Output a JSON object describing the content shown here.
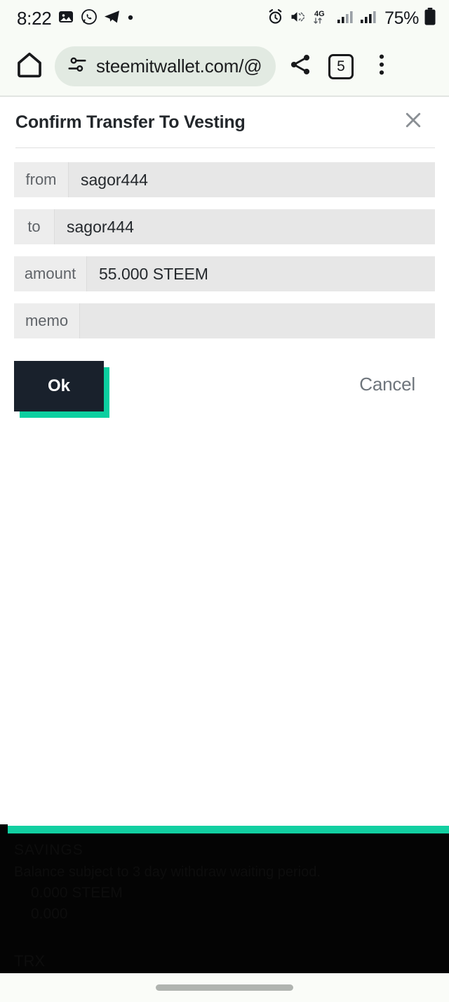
{
  "status_bar": {
    "time": "8:22",
    "left_icons": [
      "gallery-icon",
      "whatsapp-icon",
      "telegram-icon",
      "dot-icon"
    ],
    "right_icons": [
      "alarm-icon",
      "mute-icon",
      "4g-icon",
      "signal-1-icon",
      "signal-2-icon"
    ],
    "network_label": "4G",
    "battery_percent": "75%"
  },
  "browser": {
    "home_icon": "home-icon",
    "site_settings_icon": "tune-icon",
    "url": "steemitwallet.com/@",
    "share_icon": "share-icon",
    "tab_count": "5",
    "menu_icon": "more-vertical-icon",
    "url_pill_color": "#e2eae2",
    "chrome_bg": "#f8fbf6"
  },
  "dialog": {
    "title": "Confirm Transfer To Vesting",
    "close_icon": "close-icon",
    "fields": [
      {
        "label": "from",
        "value": "sagor444"
      },
      {
        "label": "to",
        "value": "sagor444"
      },
      {
        "label": "amount",
        "value": "55.000 STEEM"
      },
      {
        "label": "memo",
        "value": ""
      }
    ],
    "confirm_label": "Ok",
    "cancel_label": "Cancel",
    "confirm_bg": "#19212c",
    "confirm_shadow": "#0ccfa0",
    "cancel_color": "#6e757c"
  },
  "background_page": {
    "accent_bar_color": "#12cfa1",
    "savings_heading": "SAVINGS",
    "savings_note": "Balance subject to 3 day withdraw waiting period.",
    "savings_rows": [
      "0.000 STEEM",
      "0.000"
    ],
    "footer_label": "TRX"
  },
  "system_nav": {
    "gesture_pill": "gesture-pill"
  }
}
